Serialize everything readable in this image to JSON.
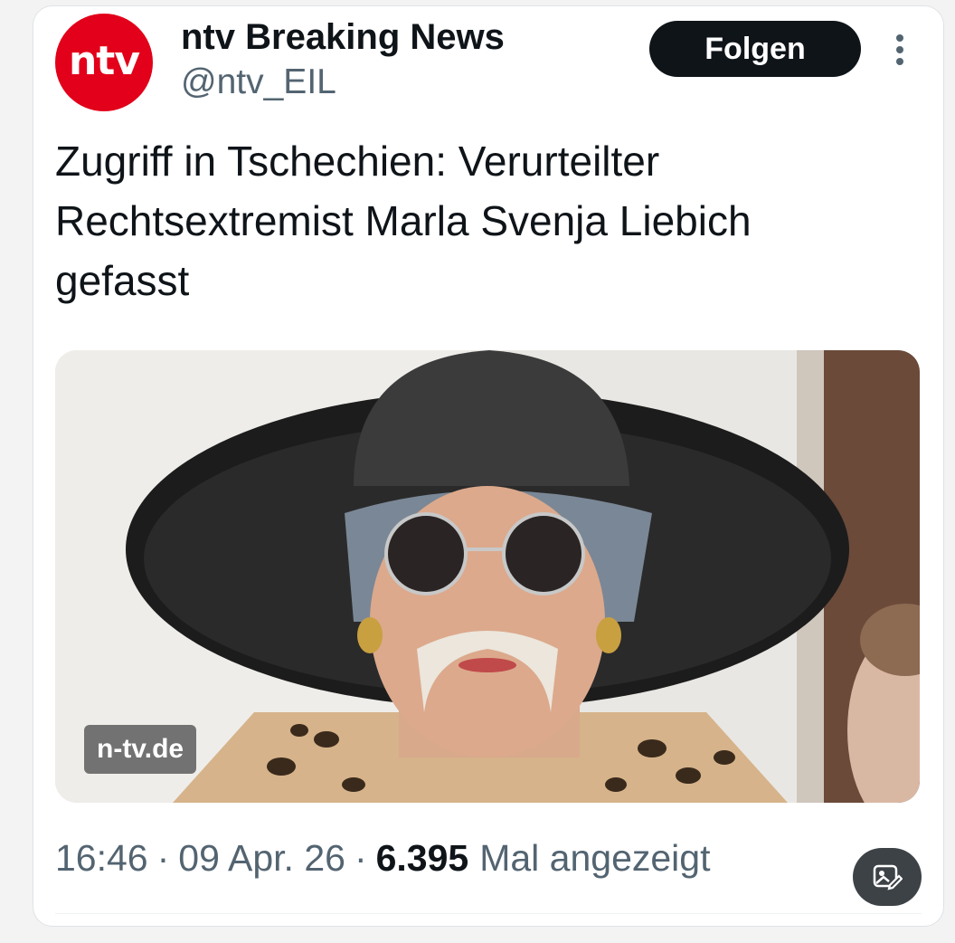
{
  "account": {
    "logo_text": "ntv",
    "display_name": "ntv Breaking News",
    "handle": "@ntv_EIL",
    "logo_color": "#e2001a"
  },
  "actions": {
    "follow_label": "Folgen",
    "more_icon": "more-vertical-icon",
    "fab_icon": "image-edit-icon"
  },
  "tweet": {
    "text": "Zugriff in Tschechien: Verurteilter Rechtsextremist Marla Svenja Liebich gefasst",
    "media_source": "n-tv.de"
  },
  "meta": {
    "time": "16:46",
    "date": "09 Apr. 26",
    "separator": "·",
    "views_count": "6.395",
    "views_label": "Mal angezeigt"
  }
}
